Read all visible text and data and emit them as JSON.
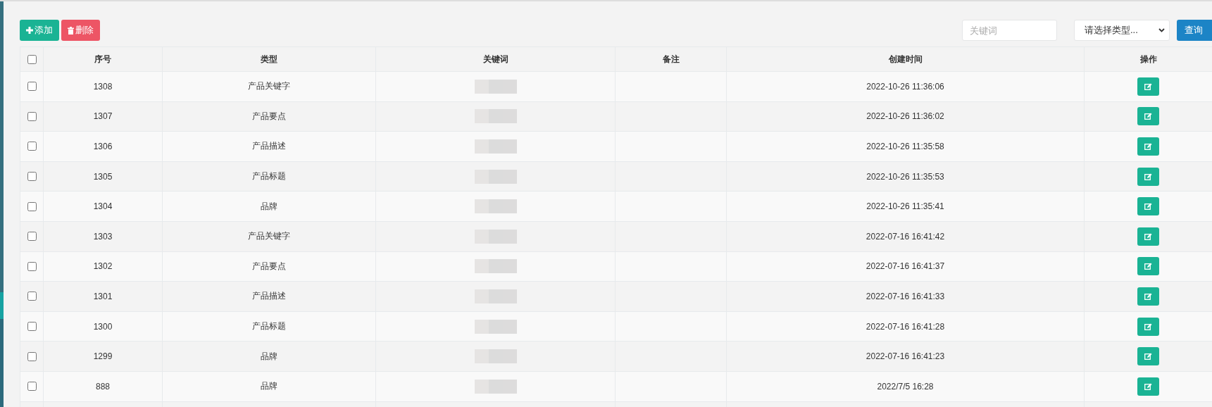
{
  "toolbar": {
    "add_button": "添加",
    "delete_button": "删除",
    "keyword_field": {
      "placeholder": "关键词"
    },
    "type_select": {
      "value": "请选择类型..."
    },
    "query_button": "查询"
  },
  "table": {
    "select_all": {
      "checked": false
    },
    "columns": [
      "序号",
      "类型",
      "关键词",
      "备注",
      "创建时间",
      "操作"
    ],
    "rows": [
      {
        "checked": false,
        "id": "1308",
        "type": "产品关键字",
        "created": "2022-10-26 11:36:06"
      },
      {
        "checked": false,
        "id": "1307",
        "type": "产品要点",
        "created": "2022-10-26 11:36:02"
      },
      {
        "checked": false,
        "id": "1306",
        "type": "产品描述",
        "created": "2022-10-26 11:35:58"
      },
      {
        "checked": false,
        "id": "1305",
        "type": "产品标题",
        "created": "2022-10-26 11:35:53"
      },
      {
        "checked": false,
        "id": "1304",
        "type": "品牌",
        "created": "2022-10-26 11:35:41"
      },
      {
        "checked": false,
        "id": "1303",
        "type": "产品关键字",
        "created": "2022-07-16 16:41:42"
      },
      {
        "checked": false,
        "id": "1302",
        "type": "产品要点",
        "created": "2022-07-16 16:41:37"
      },
      {
        "checked": false,
        "id": "1301",
        "type": "产品描述",
        "created": "2022-07-16 16:41:33"
      },
      {
        "checked": false,
        "id": "1300",
        "type": "产品标题",
        "created": "2022-07-16 16:41:28"
      },
      {
        "checked": false,
        "id": "1299",
        "type": "品牌",
        "created": "2022-07-16 16:41:23"
      },
      {
        "checked": false,
        "id": "888",
        "type": "品牌",
        "created": "2022/7/5 16:28"
      }
    ]
  }
}
